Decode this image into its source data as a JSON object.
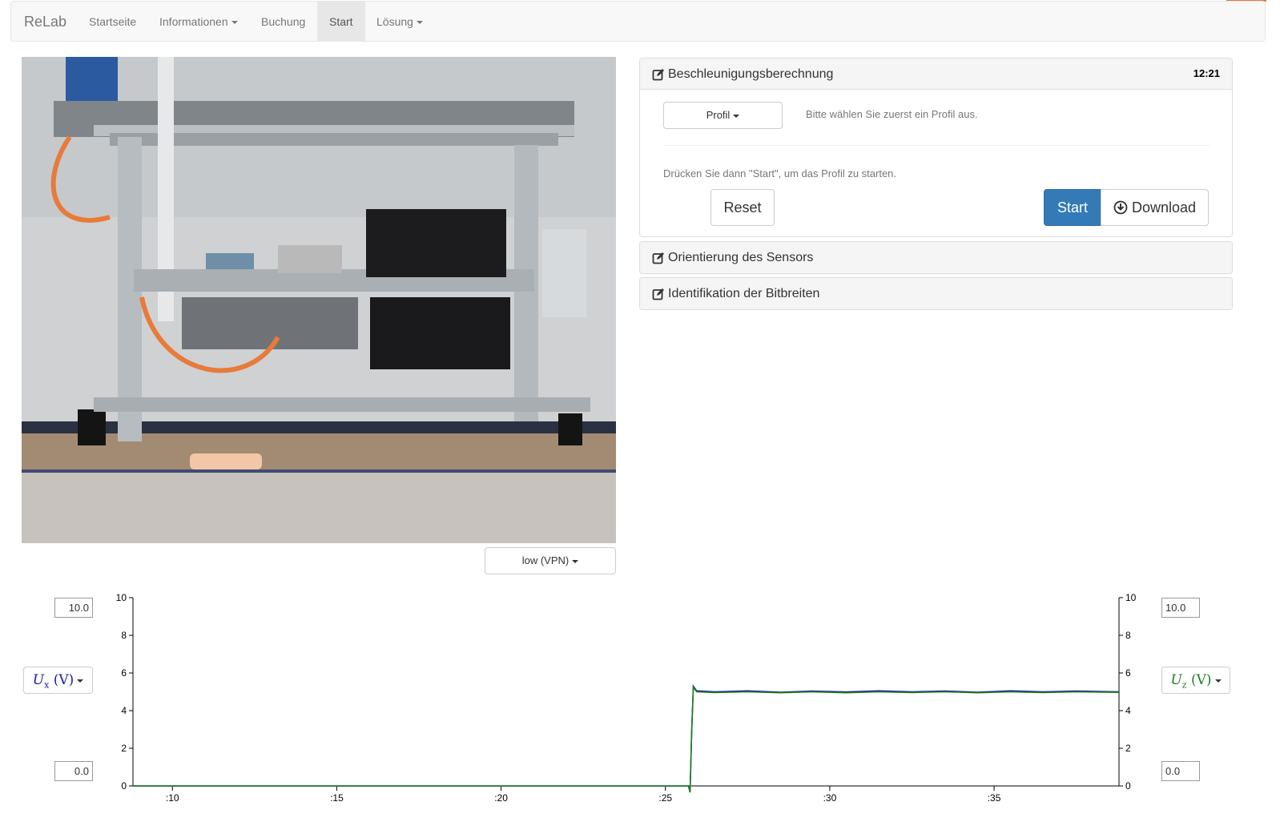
{
  "navbar": {
    "brand": "ReLab",
    "items": [
      {
        "label": "Startseite",
        "dropdown": false,
        "active": false
      },
      {
        "label": "Informationen",
        "dropdown": true,
        "active": false
      },
      {
        "label": "Buchung",
        "dropdown": false,
        "active": false
      },
      {
        "label": "Start",
        "dropdown": false,
        "active": true
      },
      {
        "label": "Lösung",
        "dropdown": true,
        "active": false
      }
    ]
  },
  "video": {
    "quality_label": "low (VPN)"
  },
  "panels": {
    "acceleration": {
      "title": "Beschleunigungsberechnung",
      "timer": "12:21",
      "profile_button": "Profil",
      "hint_select": "Bitte wählen Sie zuerst ein Profil aus.",
      "hint_start": "Drücken Sie dann \"Start\", um das Profil zu starten.",
      "reset_label": "Reset",
      "start_label": "Start",
      "download_label": "Download"
    },
    "orientation": {
      "title": "Orientierung des Sensors"
    },
    "bitwidth": {
      "title": "Identifikation der Bitbreiten"
    }
  },
  "plot_controls": {
    "left_max": "10.0",
    "left_min": "0.0",
    "right_max": "10.0",
    "right_min": "0.0",
    "left_signal": {
      "symbol": "U",
      "subscript": "x",
      "unit": "(V)"
    },
    "right_signal": {
      "symbol": "U",
      "subscript": "z",
      "unit": "(V)"
    }
  },
  "colors": {
    "accent": "#e8792d",
    "primary": "#337ab7",
    "series_x": "#1a1aa8",
    "series_z": "#1e7d1e"
  },
  "chart_data": {
    "type": "line",
    "x_tick_labels": [
      ":10",
      ":15",
      ":20",
      ":25",
      ":30",
      ":35"
    ],
    "x_ticks": [
      10,
      15,
      20,
      25,
      30,
      35
    ],
    "xlim": [
      8.8,
      38.8
    ],
    "y_left_ticks": [
      0,
      2,
      4,
      6,
      8,
      10
    ],
    "y_right_ticks": [
      0,
      2,
      4,
      6,
      8,
      10
    ],
    "ylim": [
      0,
      10
    ],
    "grid": false,
    "series": [
      {
        "name": "Ux (V)",
        "axis": "left",
        "color": "#1a1aa8",
        "points": [
          [
            8.8,
            0
          ],
          [
            25.7,
            0
          ],
          [
            25.75,
            -0.3
          ],
          [
            25.8,
            3
          ],
          [
            25.85,
            5.3
          ],
          [
            25.95,
            5.05
          ],
          [
            26.5,
            5.0
          ],
          [
            27.5,
            5.05
          ],
          [
            28.5,
            4.98
          ],
          [
            29.5,
            5.04
          ],
          [
            30.5,
            4.99
          ],
          [
            31.5,
            5.05
          ],
          [
            32.5,
            5.0
          ],
          [
            33.5,
            5.04
          ],
          [
            34.5,
            4.98
          ],
          [
            35.5,
            5.05
          ],
          [
            36.5,
            5.0
          ],
          [
            37.5,
            5.04
          ],
          [
            38.8,
            5.0
          ]
        ]
      },
      {
        "name": "Uz (V)",
        "axis": "right",
        "color": "#1e7d1e",
        "points": [
          [
            8.8,
            0
          ],
          [
            25.7,
            0
          ],
          [
            25.75,
            -0.35
          ],
          [
            25.8,
            3
          ],
          [
            25.85,
            5.25
          ],
          [
            25.95,
            5.0
          ],
          [
            26.5,
            4.96
          ],
          [
            27.5,
            5.0
          ],
          [
            28.5,
            4.95
          ],
          [
            29.5,
            5.0
          ],
          [
            30.5,
            4.95
          ],
          [
            31.5,
            5.0
          ],
          [
            32.5,
            4.96
          ],
          [
            33.5,
            5.0
          ],
          [
            34.5,
            4.95
          ],
          [
            35.5,
            5.0
          ],
          [
            36.5,
            4.96
          ],
          [
            37.5,
            5.0
          ],
          [
            38.8,
            4.97
          ]
        ]
      }
    ]
  }
}
